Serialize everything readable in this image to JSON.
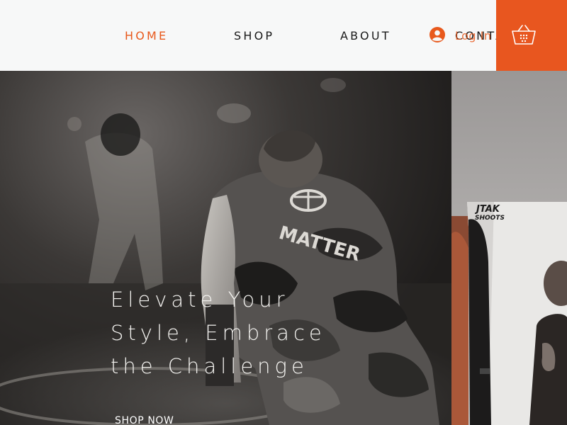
{
  "nav": {
    "home": "HOME",
    "shop": "SHOP",
    "about": "ABOUT",
    "contact": "CONTA",
    "login": "Log In",
    "active": "HOME"
  },
  "cart": {
    "icon": "basket-icon"
  },
  "hero": {
    "title_lines": [
      "Elevate Your",
      "Style, Embrace",
      "the Challenge"
    ],
    "cta": "SHOP NOW",
    "jersey_text": "MATTER"
  },
  "side": {
    "sticker_line1": "JTAK",
    "sticker_line2": "SHOOTS"
  },
  "colors": {
    "accent": "#e8561f",
    "header_bg": "#f7f8f8",
    "nav_text": "#1a1a1a",
    "hero_text": "#f3f2ef"
  }
}
